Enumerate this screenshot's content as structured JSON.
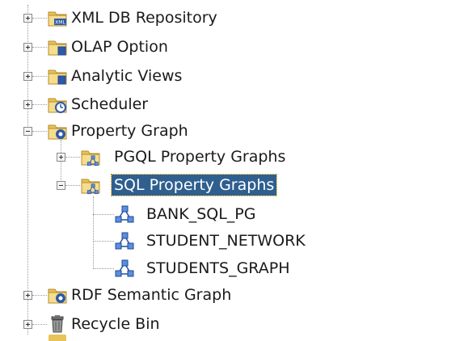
{
  "tree": {
    "items": [
      {
        "label": "XML DB Repository",
        "icon": "xml-folder-icon",
        "expanded": false
      },
      {
        "label": "OLAP Option",
        "icon": "folder-icon",
        "expanded": false
      },
      {
        "label": "Analytic Views",
        "icon": "folder-icon",
        "expanded": false
      },
      {
        "label": "Scheduler",
        "icon": "scheduler-folder-icon",
        "expanded": false
      },
      {
        "label": "Property Graph",
        "icon": "property-graph-folder-icon",
        "expanded": true
      },
      {
        "label": "PGQL Property Graphs",
        "icon": "graph-folder-icon",
        "expanded": false
      },
      {
        "label": "SQL Property Graphs",
        "icon": "graph-folder-icon",
        "expanded": true,
        "selected": true
      },
      {
        "label": "BANK_SQL_PG",
        "icon": "graph-node-icon"
      },
      {
        "label": "STUDENT_NETWORK",
        "icon": "graph-node-icon"
      },
      {
        "label": "STUDENTS_GRAPH",
        "icon": "graph-node-icon"
      },
      {
        "label": "RDF Semantic Graph",
        "icon": "property-graph-folder-icon",
        "expanded": false
      },
      {
        "label": "Recycle Bin",
        "icon": "trash-icon",
        "expanded": false
      }
    ]
  },
  "colors": {
    "selection": "#2f5f8f",
    "folder": "#e8c35a",
    "graph": "#3a6fc4"
  }
}
